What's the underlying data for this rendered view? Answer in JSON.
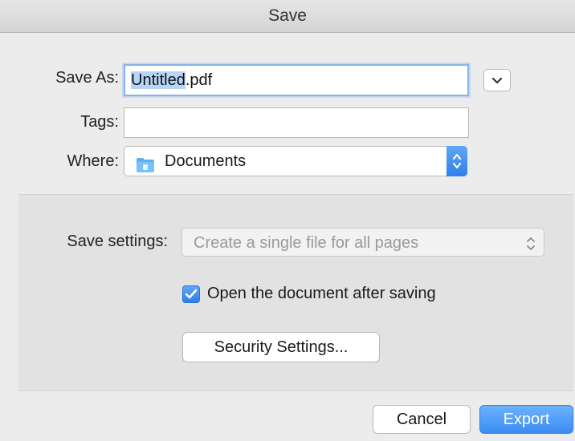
{
  "window": {
    "title": "Save"
  },
  "form": {
    "save_as_label": "Save As:",
    "filename_selected": "Untitled",
    "filename_ext": ".pdf",
    "tags_label": "Tags:",
    "tags_value": "",
    "where_label": "Where:",
    "where_value": "Documents",
    "where_icon": "folder-icon"
  },
  "options": {
    "save_settings_label": "Save settings:",
    "save_settings_value": "Create a single file for all pages",
    "open_after_label": "Open the document after saving",
    "open_after_checked": true,
    "security_button": "Security Settings..."
  },
  "buttons": {
    "cancel": "Cancel",
    "export": "Export"
  },
  "colors": {
    "accent": "#3b8cf2",
    "selection": "#b7d5f6"
  }
}
